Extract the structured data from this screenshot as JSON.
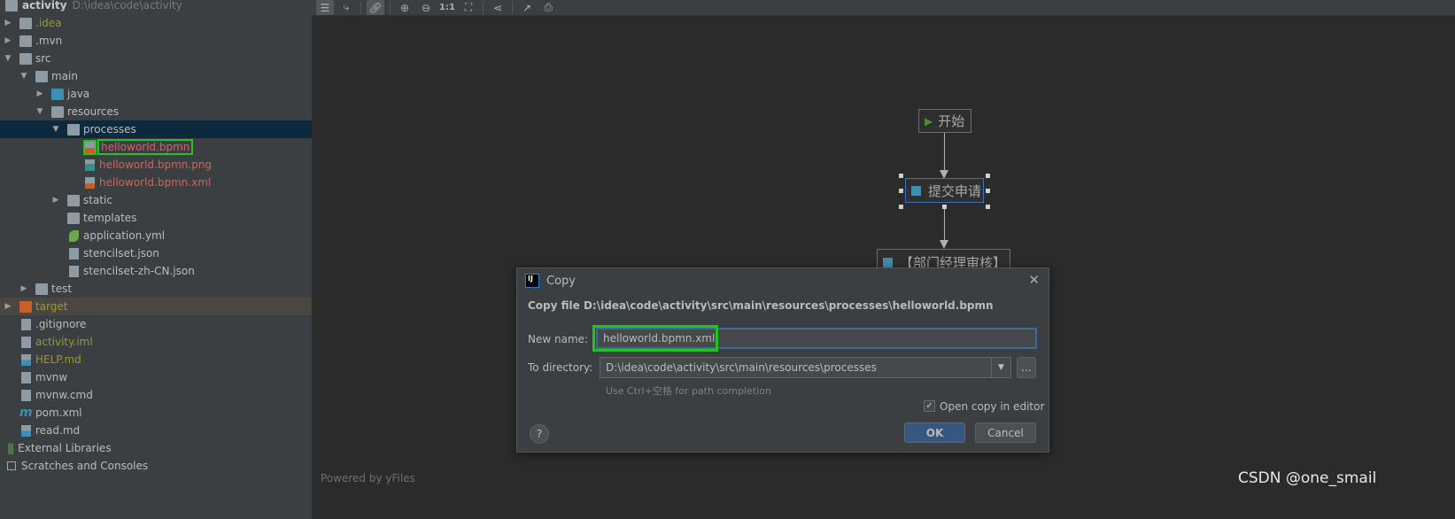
{
  "project_tree": {
    "root": {
      "name": "activity",
      "path": "D:\\idea\\code\\activity"
    },
    "items": [
      {
        "label": ".idea",
        "level": 0,
        "type": "folder",
        "expanded": false,
        "color": "olive"
      },
      {
        "label": ".mvn",
        "level": 0,
        "type": "folder",
        "expanded": false
      },
      {
        "label": "src",
        "level": 0,
        "type": "folder",
        "expanded": true
      },
      {
        "label": "main",
        "level": 1,
        "type": "folder",
        "expanded": true
      },
      {
        "label": "java",
        "level": 2,
        "type": "folder-blue",
        "expanded": false
      },
      {
        "label": "resources",
        "level": 2,
        "type": "folder",
        "expanded": true
      },
      {
        "label": "processes",
        "level": 3,
        "type": "folder",
        "expanded": true,
        "selected": true
      },
      {
        "label": "helloworld.bpmn",
        "level": 4,
        "type": "xml-file",
        "color": "red",
        "highlighted": true
      },
      {
        "label": "helloworld.bpmn.png",
        "level": 4,
        "type": "image-file",
        "color": "red"
      },
      {
        "label": "helloworld.bpmn.xml",
        "level": 4,
        "type": "xml-file",
        "color": "red"
      },
      {
        "label": "static",
        "level": 3,
        "type": "folder",
        "expanded": false
      },
      {
        "label": "templates",
        "level": 3,
        "type": "folder"
      },
      {
        "label": "application.yml",
        "level": 3,
        "type": "spring-file"
      },
      {
        "label": "stencilset.json",
        "level": 3,
        "type": "json-file"
      },
      {
        "label": "stencilset-zh-CN.json",
        "level": 3,
        "type": "json-file"
      },
      {
        "label": "test",
        "level": 1,
        "type": "folder",
        "expanded": false
      },
      {
        "label": "target",
        "level": 0,
        "type": "folder-orange",
        "expanded": false,
        "color": "olive",
        "excluded": true
      },
      {
        "label": ".gitignore",
        "level": 0,
        "type": "file"
      },
      {
        "label": "activity.iml",
        "level": 0,
        "type": "file",
        "color": "olive"
      },
      {
        "label": "HELP.md",
        "level": 0,
        "type": "md-file",
        "color": "olive"
      },
      {
        "label": "mvnw",
        "level": 0,
        "type": "shell-file"
      },
      {
        "label": "mvnw.cmd",
        "level": 0,
        "type": "file"
      },
      {
        "label": "pom.xml",
        "level": 0,
        "type": "maven-file"
      },
      {
        "label": "read.md",
        "level": 0,
        "type": "md-file"
      }
    ],
    "external_libraries": "External Libraries",
    "scratches": "Scratches and Consoles"
  },
  "toolbar": {
    "icons": [
      "settings-sliders-icon",
      "edge-route-icon",
      "link-icon",
      "zoom-in-icon",
      "zoom-out-icon",
      "actual-size-icon",
      "fit-content-icon",
      "layout-icon",
      "export-icon",
      "print-icon"
    ],
    "actual_size_label": "1:1"
  },
  "diagram": {
    "start": "开始",
    "task1": "提交申请",
    "task2": "【部门经理审核】",
    "powered_by": "Powered by yFiles"
  },
  "dialog": {
    "title": "Copy",
    "heading": "Copy file D:\\idea\\code\\activity\\src\\main\\resources\\processes\\helloworld.bpmn",
    "new_name_label": "New name:",
    "new_name_value": "helloworld.bpmn.xml",
    "to_directory_label": "To directory:",
    "to_directory_value": "D:\\idea\\code\\activity\\src\\main\\resources\\processes",
    "hint": "Use Ctrl+空格 for path completion",
    "open_copy_label": "Open copy in editor",
    "open_copy_checked": true,
    "browse_label": "...",
    "ok": "OK",
    "cancel": "Cancel",
    "help": "?"
  },
  "watermark": "CSDN @one_smail"
}
